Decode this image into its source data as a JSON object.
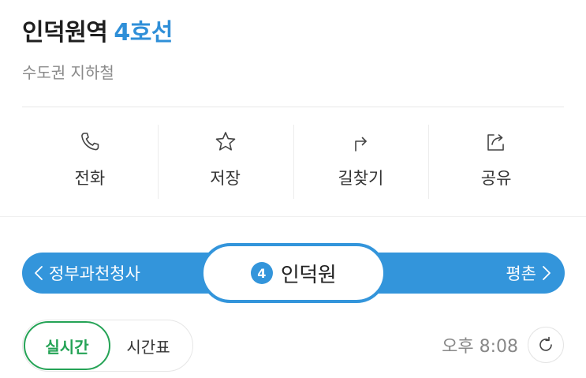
{
  "station": {
    "name": "인덕원역",
    "line": "4호선",
    "category": "수도권 지하철"
  },
  "actions": [
    {
      "label": "전화",
      "icon": "phone-icon"
    },
    {
      "label": "저장",
      "icon": "star-icon"
    },
    {
      "label": "길찾기",
      "icon": "directions-icon"
    },
    {
      "label": "공유",
      "icon": "share-icon"
    }
  ],
  "line_bar": {
    "prev_station": "정부과천청사",
    "next_station": "평촌",
    "current_station": "인덕원",
    "line_number": "4",
    "line_color": "#3395db"
  },
  "toggle": {
    "active": "실시간",
    "inactive": "시간표",
    "active_color": "#25a356"
  },
  "clock": {
    "time": "오후 8:08"
  }
}
